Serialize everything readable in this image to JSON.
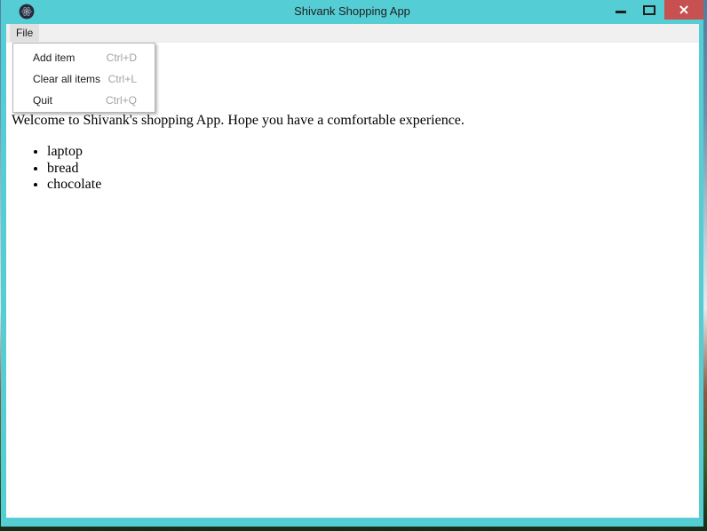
{
  "window": {
    "title": "Shivank Shopping App"
  },
  "menubar": {
    "items": [
      {
        "label": "File"
      }
    ]
  },
  "file_menu": {
    "items": [
      {
        "label": "Add item",
        "shortcut": "Ctrl+D"
      },
      {
        "label": "Clear all items",
        "shortcut": "Ctrl+L"
      },
      {
        "label": "Quit",
        "shortcut": "Ctrl+Q"
      }
    ]
  },
  "content": {
    "welcome_text": "Welcome to Shivank's shopping App. Hope you have a comfortable experience.",
    "shopping_items": [
      "laptop",
      "bread",
      "chocolate"
    ]
  },
  "colors": {
    "titlebar_teal": "#55CDD4",
    "close_button_red": "#C75050",
    "menubar_bg": "#F0F0F0",
    "shortcut_gray": "#A3A3A3"
  }
}
